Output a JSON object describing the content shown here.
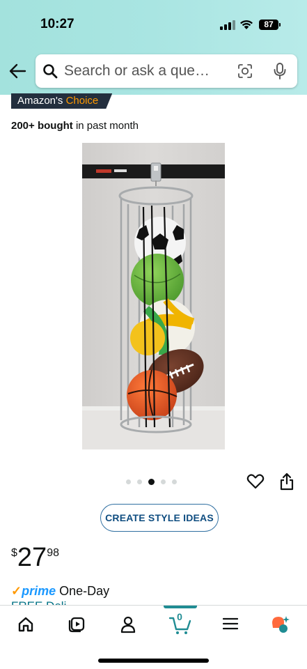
{
  "status": {
    "time": "10:27",
    "battery": "87"
  },
  "search": {
    "placeholder": "Search or ask a que…"
  },
  "badge": {
    "prefix": "Amazon's",
    "highlight": "Choice"
  },
  "social_proof": {
    "count": "200+ bought",
    "suffix": "in past month"
  },
  "product": {
    "image_alt": "Ball storage cage with soccer ball, volleyball, football and basketball",
    "image_index": 3,
    "image_total": 5
  },
  "actions": {
    "style_ideas_label": "CREATE STYLE IDEAS"
  },
  "price": {
    "symbol": "$",
    "whole": "27",
    "fraction": "98"
  },
  "delivery": {
    "check": "✓",
    "prime": "prime",
    "speed": "One-Day",
    "free_partial": "FREE Deli"
  },
  "nav": {
    "cart_count": "0"
  },
  "colors": {
    "accent_teal": "#1f8c93",
    "prime_blue": "#1a98ff",
    "badge_orange": "#ff9900",
    "header": "#a9e5e2"
  }
}
